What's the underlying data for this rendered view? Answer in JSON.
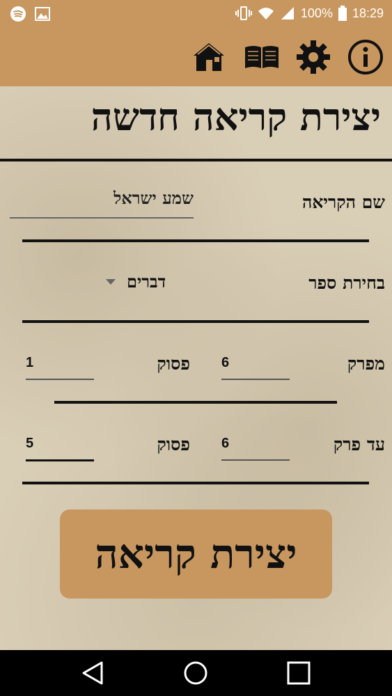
{
  "status_bar": {
    "battery": "100%",
    "time": "18:29"
  },
  "app_bar": {
    "icons": [
      "home-icon",
      "book-icon",
      "gear-icon",
      "info-icon"
    ]
  },
  "page": {
    "title": "יצירת קריאה חדשה"
  },
  "form": {
    "reading_name_label": "שם הקריאה",
    "reading_name_value": "שמע ישראל",
    "book_label": "בחירת ספר",
    "book_value": "דברים",
    "from_chapter_label": "מפרק",
    "from_chapter_value": "6",
    "from_verse_label": "פסוק",
    "from_verse_value": "1",
    "to_chapter_label": "עד פרק",
    "to_chapter_value": "6",
    "to_verse_label": "פסוק",
    "to_verse_value": "5"
  },
  "create_button": {
    "label": "יצירת קריאה"
  }
}
